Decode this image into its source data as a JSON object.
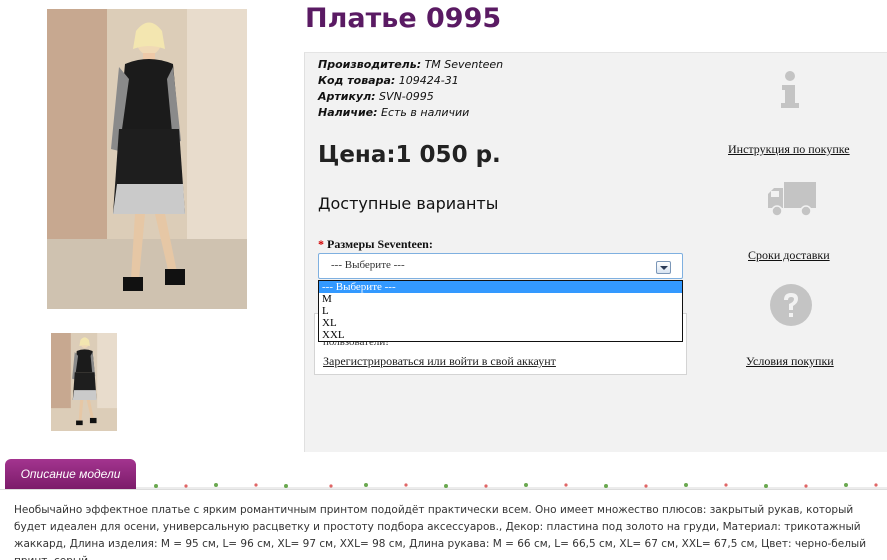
{
  "product": {
    "title": "Платье 0995",
    "info": [
      {
        "label": "Производитель:",
        "value": " TM Seventeen"
      },
      {
        "label": "Код товара:",
        "value": " 109424-31"
      },
      {
        "label": "Артикул:",
        "value": " SVN-0995"
      },
      {
        "label": "Наличие:",
        "value": " Есть в наличии"
      }
    ],
    "price": "Цена:1 050 р."
  },
  "options": {
    "heading": "Доступные варианты",
    "required_mark": "*",
    "size_label": "Размеры Seventeen:",
    "select_value": "--- Выберите ---",
    "dropdown_items": [
      "--- Выберите ---",
      "M",
      "L",
      "XL",
      "XXL"
    ]
  },
  "notice": {
    "text": "пользователи!",
    "link": "Зарегистрироваться или войти в свой аккаунт"
  },
  "sidebar": {
    "links": [
      {
        "label": "Инструкция по покупке",
        "icon": "info-icon"
      },
      {
        "label": "Сроки доставки",
        "icon": "truck-icon"
      },
      {
        "label": "Условия покупки",
        "icon": "question-icon"
      }
    ]
  },
  "description": {
    "tab_label": "Описание модели",
    "text": "Необычайно эффектное платье с ярким романтичным принтом подойдёт практически всем. Оно имеет множество плюсов: закрытый рукав, который будет идеален для осени, универсальную расцветку и простоту подбора аксессуаров., Декор: пластина под золото на груди, Материал: трикотажный жаккард, Длина изделия: M = 95 см, L= 96 см, XL= 97 см, XXL= 98 см, Длина рукава: M = 66 см, L= 66,5 см, XL= 67 см, XXL= 67,5 см, Цвет: черно-белый принт, серый"
  },
  "colors": {
    "title": "#5a1a63",
    "tab": "#8e2780",
    "selection": "#3399ff",
    "panel": "#f2f2f2"
  }
}
